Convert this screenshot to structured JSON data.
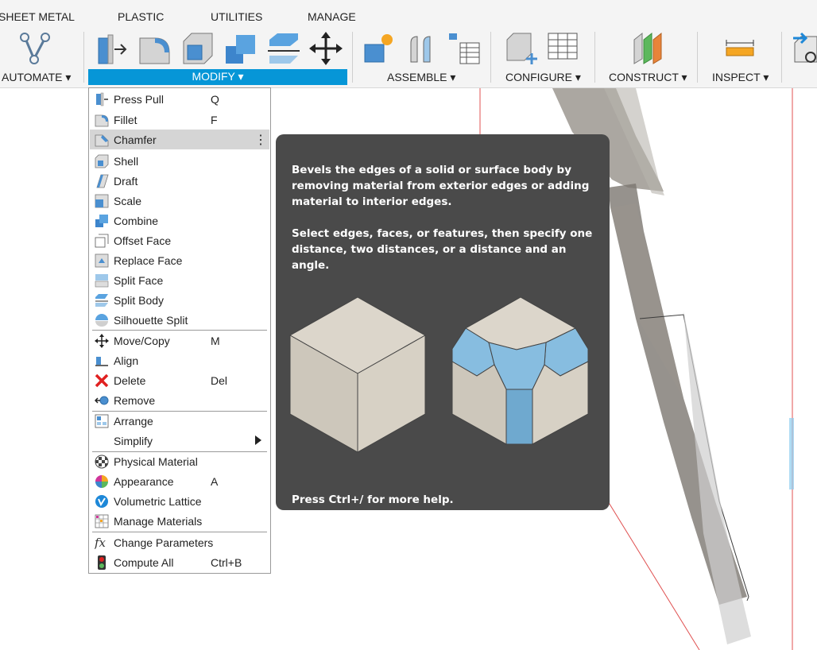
{
  "tabs": [
    "SHEET METAL",
    "PLASTIC",
    "UTILITIES",
    "MANAGE"
  ],
  "groups": {
    "automate": "AUTOMATE ▾",
    "modify": "MODIFY ▾",
    "assemble": "ASSEMBLE ▾",
    "configure": "CONFIGURE ▾",
    "construct": "CONSTRUCT ▾",
    "inspect": "INSPECT ▾"
  },
  "menu": {
    "items": [
      {
        "label": "Press Pull",
        "shortcut": "Q",
        "icon": "press-pull-icon"
      },
      {
        "label": "Fillet",
        "shortcut": "F",
        "icon": "fillet-icon"
      },
      {
        "label": "Chamfer",
        "shortcut": "",
        "icon": "chamfer-icon",
        "more": "⋮"
      },
      {
        "label": "Shell",
        "shortcut": "",
        "icon": "shell-icon"
      },
      {
        "label": "Draft",
        "shortcut": "",
        "icon": "draft-icon"
      },
      {
        "label": "Scale",
        "shortcut": "",
        "icon": "scale-icon"
      },
      {
        "label": "Combine",
        "shortcut": "",
        "icon": "combine-icon"
      },
      {
        "label": "Offset Face",
        "shortcut": "",
        "icon": "offset-face-icon"
      },
      {
        "label": "Replace Face",
        "shortcut": "",
        "icon": "replace-face-icon"
      },
      {
        "label": "Split Face",
        "shortcut": "",
        "icon": "split-face-icon"
      },
      {
        "label": "Split Body",
        "shortcut": "",
        "icon": "split-body-icon"
      },
      {
        "label": "Silhouette Split",
        "shortcut": "",
        "icon": "silhouette-split-icon"
      },
      {
        "label": "Move/Copy",
        "shortcut": "M",
        "icon": "move-icon"
      },
      {
        "label": "Align",
        "shortcut": "",
        "icon": "align-icon"
      },
      {
        "label": "Delete",
        "shortcut": "Del",
        "icon": "delete-icon"
      },
      {
        "label": "Remove",
        "shortcut": "",
        "icon": "remove-icon"
      },
      {
        "label": "Arrange",
        "shortcut": "",
        "icon": "arrange-icon"
      },
      {
        "label": "Simplify",
        "shortcut": "",
        "icon": "",
        "submenu": true
      },
      {
        "label": "Physical Material",
        "shortcut": "",
        "icon": "physical-material-icon"
      },
      {
        "label": "Appearance",
        "shortcut": "A",
        "icon": "appearance-icon"
      },
      {
        "label": "Volumetric Lattice",
        "shortcut": "",
        "icon": "volumetric-lattice-icon"
      },
      {
        "label": "Manage Materials",
        "shortcut": "",
        "icon": "manage-materials-icon"
      },
      {
        "label": "Change Parameters",
        "shortcut": "",
        "icon": "fx-icon"
      },
      {
        "label": "Compute All",
        "shortcut": "Ctrl+B",
        "icon": "compute-all-icon"
      }
    ]
  },
  "tooltip": {
    "para1": "Bevels the edges of a solid or surface body by removing material from exterior edges or adding material to interior edges.",
    "para2": "Select edges, faces, or features, then specify one distance, two distances, or a distance and an angle.",
    "footer": "Press Ctrl+/ for more help."
  },
  "colors": {
    "accent": "#0696d7",
    "tooltip_bg": "#4a4a4a",
    "menu_highlight": "#d5d5d5",
    "chamfer_blue": "#87bde0"
  }
}
